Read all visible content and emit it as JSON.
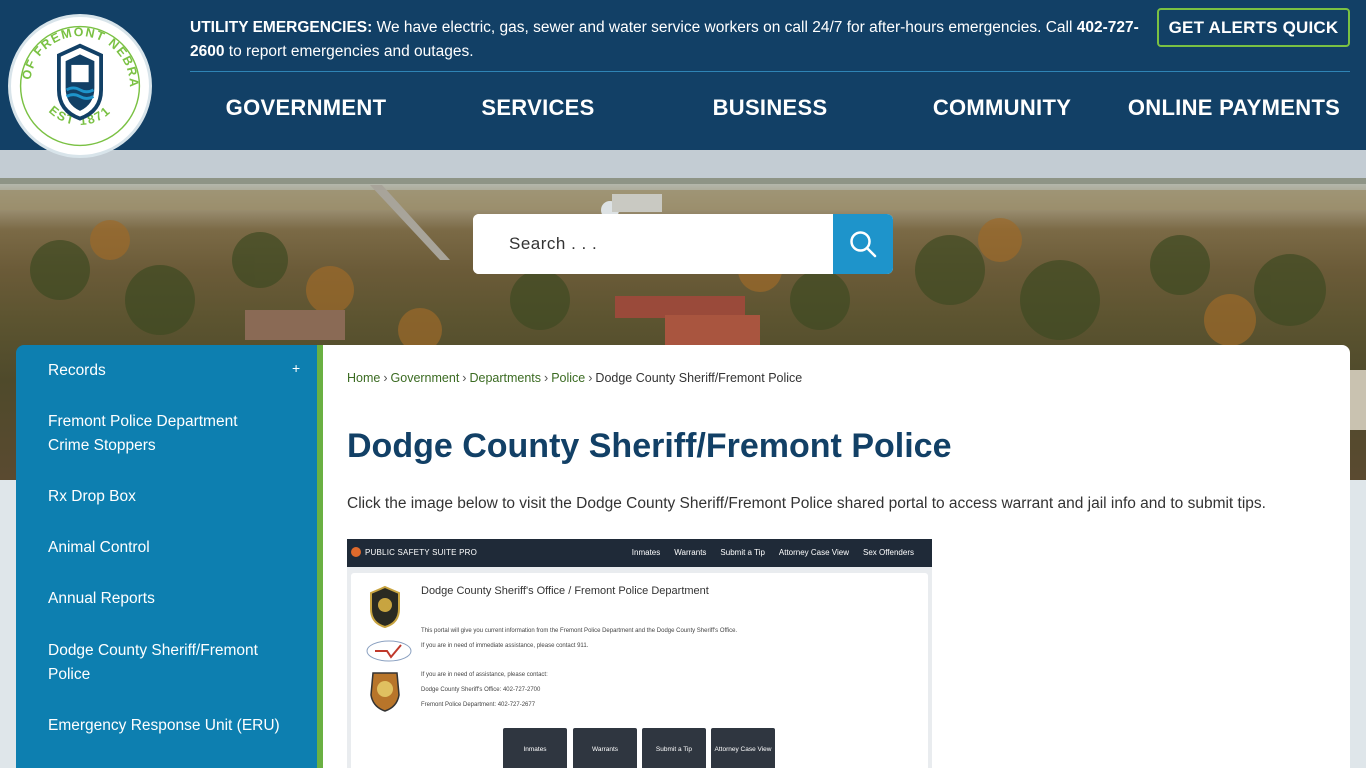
{
  "header": {
    "logo": {
      "ring_text_top": "CITY OF FREMONT NEBRASKA",
      "ring_text_bottom": "EST 1871"
    },
    "alert": {
      "label": "UTILITY EMERGENCIES:",
      "text_before_phone": " We have electric, gas, sewer and water service workers on call 24/7 for after-hours emergencies. Call ",
      "phone": "402-727-2600",
      "text_after_phone": " to report emergencies and outages."
    },
    "alerts_button": "GET ALERTS QUICK",
    "nav": [
      "GOVERNMENT",
      "SERVICES",
      "BUSINESS",
      "COMMUNITY",
      "ONLINE PAYMENTS"
    ]
  },
  "search": {
    "placeholder": "Search . . .",
    "icon": "search-icon"
  },
  "sidebar": {
    "items": [
      {
        "label": "Records",
        "expandable": "+"
      },
      {
        "label": "Fremont Police Department Crime Stoppers"
      },
      {
        "label": "Rx Drop Box"
      },
      {
        "label": "Animal Control"
      },
      {
        "label": "Annual Reports"
      },
      {
        "label": "Dodge County Sheriff/Fremont Police"
      },
      {
        "label": "Emergency Response Unit (ERU)"
      }
    ]
  },
  "breadcrumb": [
    "Home",
    "Government",
    "Departments",
    "Police",
    "Dodge County Sheriff/Fremont Police"
  ],
  "page": {
    "title": "Dodge County Sheriff/Fremont Police",
    "intro": "Click the image below to visit the Dodge County Sheriff/Fremont Police shared portal to access warrant and jail info and to submit tips."
  },
  "portal": {
    "brand": "PUBLIC SAFETY SUITE PRO",
    "nav": [
      "Inmates",
      "Warrants",
      "Submit a Tip",
      "Attorney Case View",
      "Sex Offenders"
    ],
    "heading": "Dodge County Sheriff's Office / Fremont Police Department",
    "line1": "This portal will give you current information from the Fremont Police Department and the Dodge County Sheriff's Office.",
    "line2": "If you are in need of immediate assistance, please contact 911.",
    "line3": "If you are in need of assistance, please contact:",
    "line4": "Dodge County Sheriff's Office:  402-727-2700",
    "line5": "Fremont Police Department:  402-727-2677",
    "buttons": [
      "Inmates",
      "Warrants",
      "Submit a Tip",
      "Attorney Case View"
    ]
  },
  "colors": {
    "header_bg": "#124066",
    "accent_green": "#7ac143",
    "sidebar_bg": "#0d7fb0",
    "search_btn": "#1e94cb",
    "title": "#124066"
  }
}
